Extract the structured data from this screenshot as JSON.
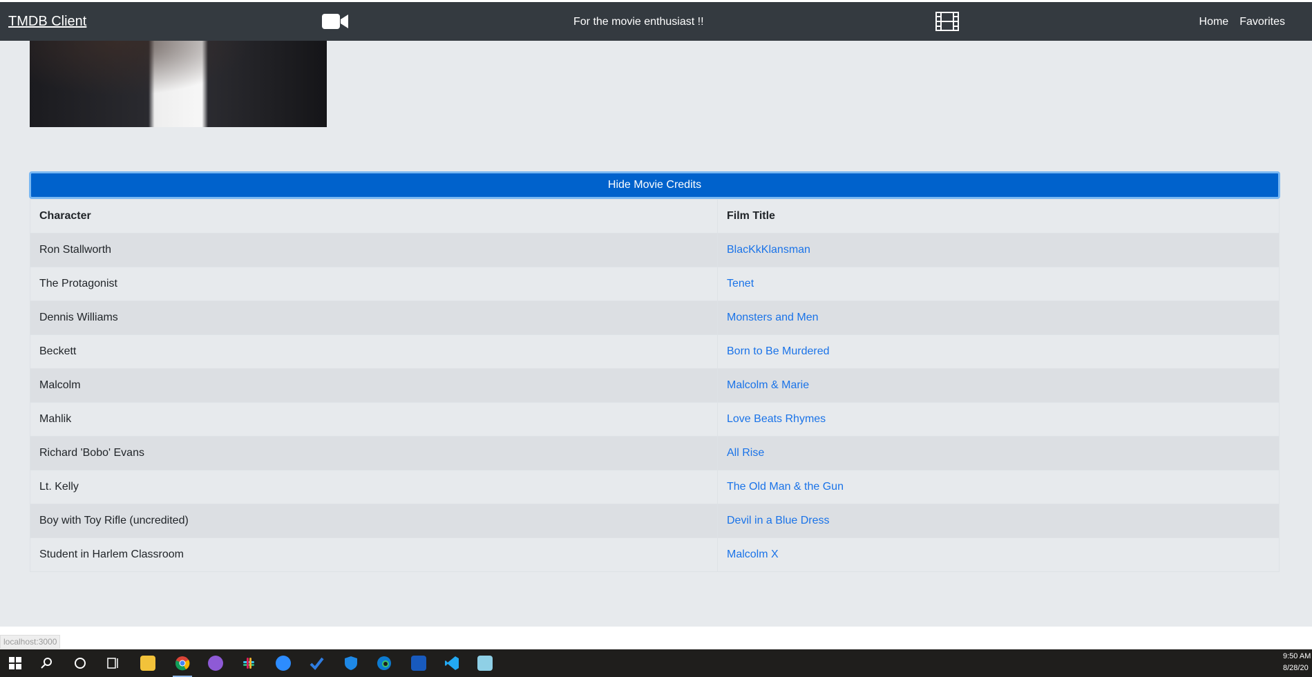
{
  "navbar": {
    "brand": "TMDB Client",
    "tagline": "For the movie enthusiast !!",
    "links": [
      "Home",
      "Favorites"
    ],
    "bg_color": "#343a40"
  },
  "credits_toggle_label": "Hide Movie Credits",
  "credits_table": {
    "headers": [
      "Character",
      "Film Title"
    ],
    "rows": [
      {
        "character": "Ron Stallworth",
        "film": "BlacKkKlansman"
      },
      {
        "character": "The Protagonist",
        "film": "Tenet"
      },
      {
        "character": "Dennis Williams",
        "film": "Monsters and Men"
      },
      {
        "character": "Beckett",
        "film": "Born to Be Murdered"
      },
      {
        "character": "Malcolm",
        "film": "Malcolm & Marie"
      },
      {
        "character": "Mahlik",
        "film": "Love Beats Rhymes"
      },
      {
        "character": "Richard 'Bobo' Evans",
        "film": "All Rise"
      },
      {
        "character": "Lt. Kelly",
        "film": "The Old Man & the Gun"
      },
      {
        "character": "Boy with Toy Rifle (uncredited)",
        "film": "Devil in a Blue Dress"
      },
      {
        "character": "Student in Harlem Classroom",
        "film": "Malcolm X"
      }
    ]
  },
  "status_url": "localhost:3000",
  "taskbar": {
    "icons": [
      "windows-start",
      "search",
      "cortana",
      "task-view",
      "file-explorer",
      "chrome",
      "app-purple",
      "slack",
      "zoom",
      "todo",
      "defender",
      "edge",
      "word",
      "vscode",
      "notepad"
    ],
    "clock_time": "9:50 AM",
    "clock_date": "8/28/20"
  },
  "colors": {
    "button_blue": "#0062cc",
    "link_blue": "#1a73e8",
    "page_bg": "#e7eaed"
  }
}
